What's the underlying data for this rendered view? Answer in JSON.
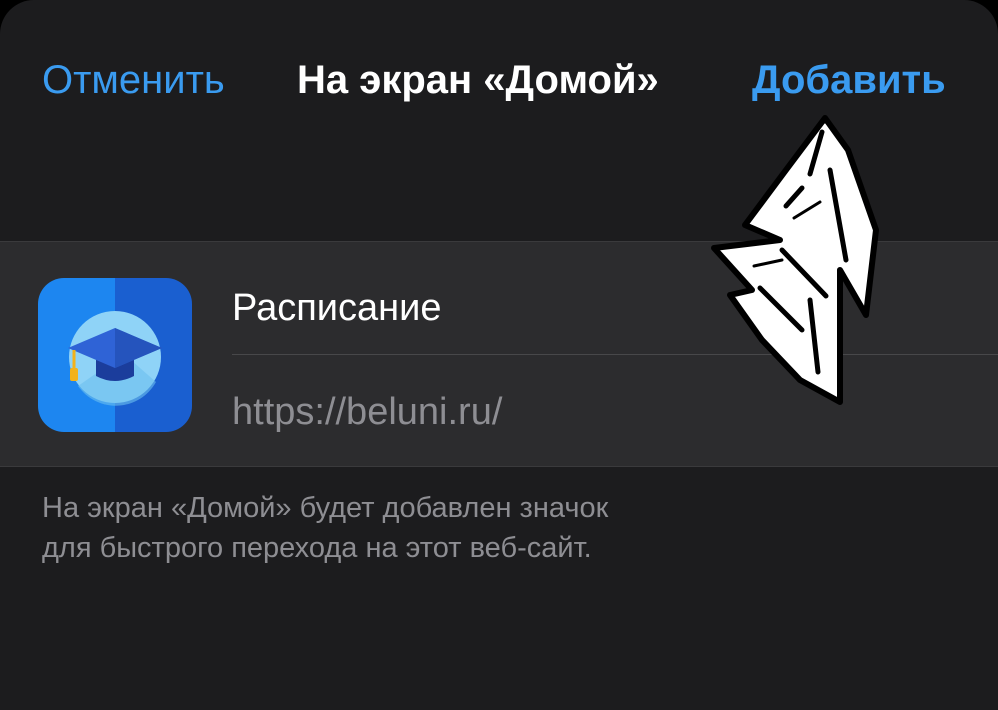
{
  "navbar": {
    "cancel_label": "Отменить",
    "title": "На экран «Домой»",
    "add_label": "Добавить"
  },
  "bookmark": {
    "name": "Расписание",
    "url": "https://beluni.ru/"
  },
  "footer": {
    "line1": "На экран «Домой» будет добавлен значок",
    "line2": "для быстрого перехода на этот веб-сайт."
  },
  "icons": {
    "app_icon": "graduation-cap-icon",
    "annotation": "hand-drawn-arrow"
  },
  "colors": {
    "accent": "#3a9bf0",
    "background": "#1c1c1e",
    "card": "#2c2c2e",
    "secondary_text": "#8e8e93"
  }
}
